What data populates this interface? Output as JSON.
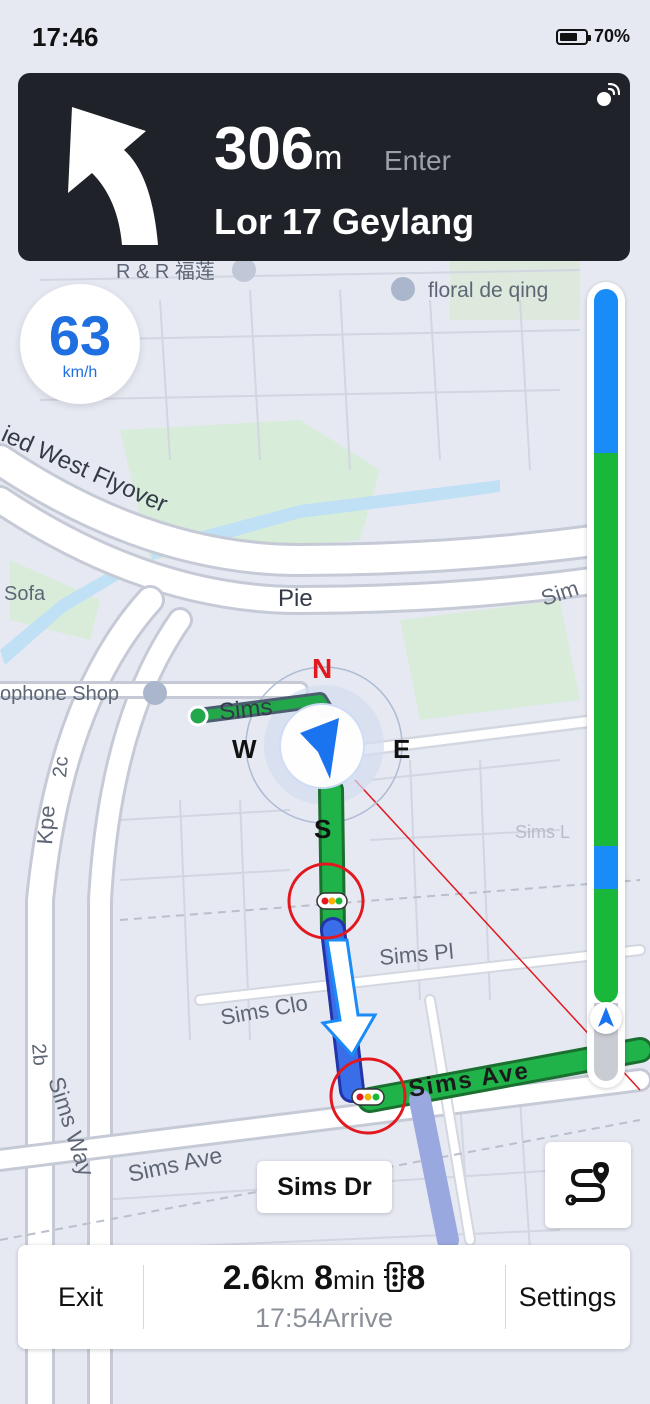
{
  "status_bar": {
    "time": "17:46",
    "battery": "70%"
  },
  "guidance": {
    "distance_value": "306",
    "distance_unit": "m",
    "action": "Enter",
    "road": "Lor 17 Geylang"
  },
  "speed": {
    "value": "63",
    "unit": "km/h"
  },
  "map_labels": {
    "rr": "R & R 福莲",
    "floral": "floral de qing",
    "flyover": "ied West Flyover",
    "sofa": "Sofa",
    "pie": "Pie",
    "sim_right": "Sim",
    "phone_shop": "ophone Shop",
    "sims_top": "Sims",
    "sims_pl": "Sims Pl",
    "sims_clo": "Sims Clo",
    "sims_ave_main": "Sims Ave",
    "sims_ave_left": "Sims Ave",
    "sims_way": "Sims Way",
    "kpe": "Kpe",
    "two_c": "2c",
    "two_b": "2b",
    "sims_faint": "Sims L",
    "compass_n": "N",
    "compass_s": "S",
    "compass_e": "E",
    "compass_w": "W"
  },
  "current_street": "Sims Dr",
  "bottom": {
    "exit_label": "Exit",
    "distance": "2.6",
    "distance_unit": "km",
    "duration": "8",
    "duration_unit": "min",
    "traffic_lights": "8",
    "arrival_time": "17:54",
    "arrival_label": "Arrive",
    "settings_label": "Settings"
  },
  "progress": {
    "segments": [
      {
        "status": "clear",
        "color": "#1a8cf7",
        "fraction": 0.23
      },
      {
        "status": "smooth",
        "color": "#19b83a",
        "fraction": 0.55
      },
      {
        "status": "clear",
        "color": "#1a8cf7",
        "fraction": 0.06
      },
      {
        "status": "smooth",
        "color": "#19b83a",
        "fraction": 0.16
      }
    ]
  },
  "colors": {
    "route_green": "#1fb34a",
    "route_blue": "#3a6ee8",
    "nav_card": "#1f2229",
    "speed_blue": "#1f6fe0",
    "highlight_red": "#e2181e"
  },
  "icons": {
    "turn": "turn-left-arrow-icon",
    "voice": "satellite-signal-icon",
    "traffic_light": "traffic-light-icon",
    "route": "route-overview-icon",
    "navigation": "navigation-arrow-icon"
  }
}
